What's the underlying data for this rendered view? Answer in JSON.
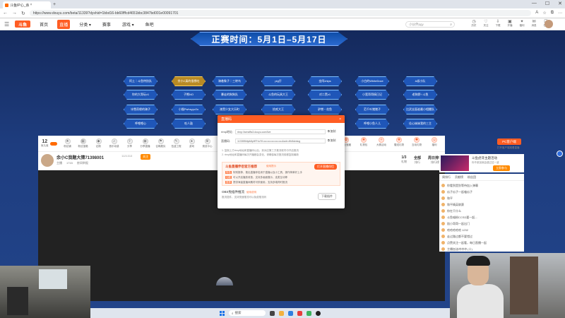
{
  "browser": {
    "tab_title": "斗鱼IP心_余小C真的很想吃大鸡...",
    "url": "https://www.douyu.com/beta/11339?dyshid=1bbd16-bb60fffcd4651bbc3847bd001e00091701",
    "nav": [
      "←",
      "→",
      "↻"
    ],
    "icons": [
      "A",
      "☆",
      "⧉",
      "⋯"
    ]
  },
  "site": {
    "logo": "斗鱼",
    "nav": [
      {
        "label": "首页",
        "active": false
      },
      {
        "label": "直播",
        "active": true
      },
      {
        "label": "分类 ▾",
        "active": false
      },
      {
        "label": "赛事",
        "active": false
      },
      {
        "label": "游戏 ▾",
        "active": false
      },
      {
        "label": "鱼吧",
        "active": false
      }
    ],
    "search_placeholder": "小伙伴pgy",
    "header_icons": [
      "历史",
      "关注",
      "下载",
      "开播",
      "福利",
      "消息",
      "任务"
    ]
  },
  "banner": {
    "text": "正赛时间：5月1日–5月17日"
  },
  "teams": {
    "row1": [
      "阿土｜斗鱼特别队",
      "余小C真的很想吃",
      "骑着象子｜三转鸟",
      "pig仔",
      "金阿chips",
      "小白的WhiteDove",
      "A叔小队"
    ],
    "row2": [
      "你的大哥玩v1",
      "子熊NO",
      "暴走的狗狗队",
      "斗鱼的玩具大王",
      "对二黑v1",
      "小宽哥哥搞日记",
      "老狗野♀斗鱼"
    ],
    "row3": [
      "冰雪奇缘的骑子",
      "小猴Pwhsyyv2u",
      "漆黑少女大乐町",
      "拾贰大王",
      "驴憎・花鱼",
      "范千叶猪猪子",
      "比武丝面谁最小相鲤队"
    ],
    "row4": [
      "呼哩哩心",
      "吃人鼓",
      "",
      "",
      "呼哩小鱼人儿",
      "佳心妹妹我的三主"
    ]
  },
  "toolbar": {
    "level": "12",
    "level_label": "鱼丸值",
    "items": [
      "粉丝铺",
      "粉丝宝箱",
      "钻粉",
      "音乐动感",
      "分享",
      "分享直播",
      "召唤舰队",
      "伍迪工程",
      "游戏",
      "竞技中心"
    ],
    "right_items": [
      "开启头像",
      "荣耀超级",
      "粉丝宝藏",
      "礼物包",
      "大赛活动",
      "赠送礼物",
      "互动礼物",
      "福利"
    ],
    "pc_button": "PC客户端",
    "right_link": "打开客户端观看直播"
  },
  "room": {
    "title": "余小C我题大猜71398001",
    "badge": "1121313",
    "follow": "关注",
    "sub": [
      "主播",
      "1715",
      "房间举报"
    ],
    "stats": [
      {
        "value": "1/3",
        "label": "礼物"
      },
      {
        "value": "全部",
        "label": "排行"
      },
      {
        "value": "周日排行",
        "label": "排行榜"
      }
    ]
  },
  "promo": {
    "title": "斗鱼虎牙主题活动",
    "sub": "你不参加就会错过这一波",
    "button": "立即参与"
  },
  "chat": {
    "tabs": [
      "周排行",
      "贡献榜",
      "粉丝团"
    ],
    "messages": [
      "你看到是别等待加入弹幕",
      "瓜子瓜子一起嗑瓜子",
      "和平",
      "和平精英联赛",
      "你在干什么",
      "斗鱼喵粉CCSD要一起...",
      "陪小哥哥一起出门",
      "哈哈哈哈哈 1232",
      "走过路过都不要错过",
      "点赞关注一起看，每日直播一起",
      "主播加油冲冲冲 (十)"
    ]
  },
  "modal": {
    "title": "直播码",
    "close": "×",
    "rtmp_label": "rtmp地址:",
    "rtmp_value": "rtmp://sendfts3.douyu.com/live",
    "code_label": "直播码:",
    "code_value": "11339Bhlylk8pHFHuYK••••••••••••••••••••••&cdn=ffcfkkmtcg",
    "copy": "复制",
    "notes": [
      "1. 复制上方rtmp地址和直播码以后，到对应第三方推流软件中开启推流",
      "2. rtmp地址和直播码每次开播都会变化，请确保每次推流前都复制最新"
    ],
    "rec_title": "斗鱼直播伴侣官方推荐",
    "rec_tag": "使用提示",
    "rec_button": "打开直播伴侣",
    "rec_lines": [
      {
        "tag": "特色",
        "text": "特别推荐，推出直播伴侣用于直播以及小工具，操作简单好上手"
      },
      {
        "tag": "功能",
        "text": "可以开启播放收音，支持多画面展示，连麦互动等"
      },
      {
        "tag": "推荐",
        "text": "提供海量直播间素材可供使用，支持多端同时推流"
      }
    ],
    "obs_title": "OBS免插件推流",
    "obs_tag": "使用说明",
    "obs_desc": "推流插件，支持快速推流可以免费推流码",
    "obs_button": "下载插件"
  },
  "taskbar": {
    "search": "搜索"
  },
  "colors": {
    "brand": "#ff5d23",
    "banner_blue": "#1f56b8",
    "gold": "#b98a24"
  }
}
